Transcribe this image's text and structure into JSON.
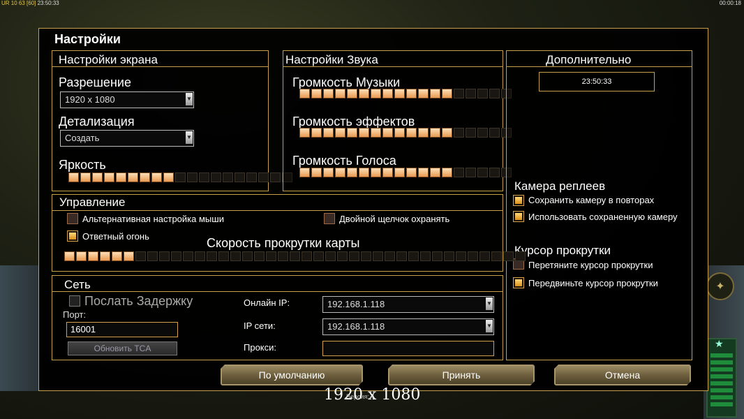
{
  "topbar": {
    "left_prefix": "UR 10 63",
    "left_fps": "[60]",
    "left_time": "23:50:33",
    "right_time": "00:00:18"
  },
  "window": {
    "title": "Настройки"
  },
  "screen": {
    "title": "Настройки экрана",
    "resolution_label": "Разрешение",
    "resolution_value": "1920 x 1080",
    "detail_label": "Детализация",
    "detail_value": "Создать",
    "brightness_label": "Яркость",
    "brightness_level": 9,
    "brightness_max": 19
  },
  "sound": {
    "title": "Настройки Звука",
    "music_label": "Громкость Музыки",
    "music_level": 13,
    "effects_label": "Громкость эффектов",
    "effects_level": 13,
    "voice_label": "Громкость Голоса",
    "voice_level": 13,
    "max": 18
  },
  "extra": {
    "title": "Дополнительно",
    "clock": "23:50:33",
    "replay_camera_title": "Камера реплеев",
    "replay_save_label": "Сохранить камеру в повторах",
    "replay_use_label": "Использовать сохраненную камеру",
    "scroll_cursor_title": "Курсор прокрутки",
    "scroll_drag_label": "Перетяните курсор прокрутки",
    "scroll_move_label": "Передвиньте курсор прокрутки"
  },
  "control": {
    "title": "Управление",
    "alt_mouse_label": "Альтернативная настройка мыши",
    "double_click_label": "Двойной щелчок охранять",
    "return_fire_label": "Ответный огонь",
    "scroll_speed_label": "Скорость прокрутки карты",
    "scroll_speed_level": 6,
    "scroll_speed_max": 39
  },
  "network": {
    "title": "Сеть",
    "send_delay_label": "Послать Задержку",
    "port_label": "Порт:",
    "port_value": "16001",
    "update_tca_label": "Обновить TCA",
    "online_ip_label": "Онлайн IP:",
    "online_ip_value": "192.168.1.118",
    "lan_ip_label": "IP сети:",
    "lan_ip_value": "192.168.1.118",
    "proxy_label": "Прокси:",
    "proxy_value": ""
  },
  "buttons": {
    "default": "По умолчанию",
    "accept": "Принять",
    "cancel": "Отмена"
  },
  "footer": {
    "resolution_text": "1920 x 1080",
    "version_text": "Версия: 4"
  },
  "colors": {
    "accent": "#c7a14a",
    "slider_on": "#e89a52"
  },
  "icons": {
    "radar": "radar-icon",
    "power": "star-icon"
  }
}
